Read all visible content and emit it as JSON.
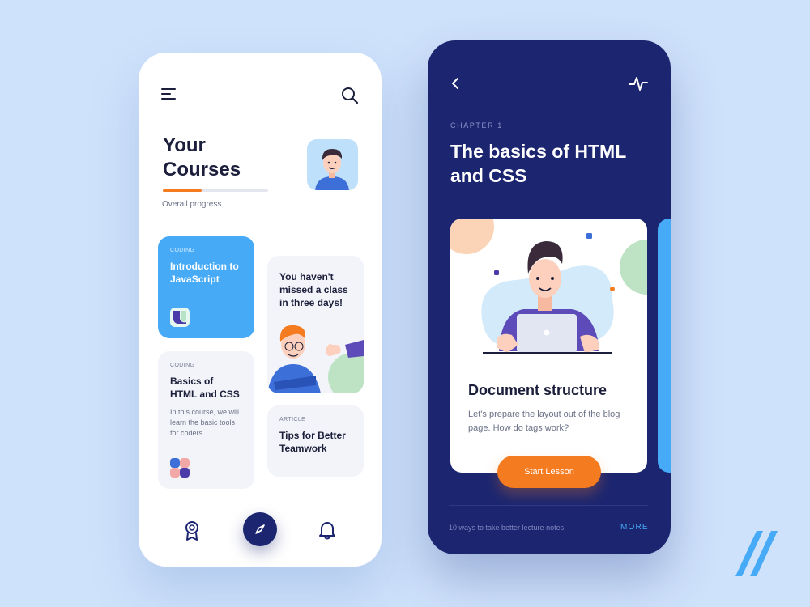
{
  "left_screen": {
    "header": {
      "menu_icon": "menu-icon",
      "search_icon": "search-icon"
    },
    "title": "Your\nCourses",
    "progress": {
      "label": "Overall progress",
      "value_percent": 37,
      "color": "#f47b20"
    },
    "cards": {
      "javascript": {
        "category": "CODING",
        "title": "Introduction to JavaScript",
        "color": "#46aaf7"
      },
      "html_css": {
        "category": "CODING",
        "title": "Basics of HTML and CSS",
        "description": "In this course, we will learn the basic tools for coders."
      },
      "message": {
        "text": "You haven't missed a class in three days!"
      },
      "tips": {
        "category": "ARTICLE",
        "title": "Tips for Better Teamwork"
      }
    },
    "bottom_nav": [
      {
        "name": "badge",
        "icon": "badge-icon"
      },
      {
        "name": "explore",
        "icon": "compass-icon",
        "active": true
      },
      {
        "name": "notifications",
        "icon": "bell-icon"
      }
    ]
  },
  "right_screen": {
    "header": {
      "back_icon": "chevron-left-icon",
      "activity_icon": "pulse-icon"
    },
    "chapter": "CHAPTER 1",
    "title": "The basics of HTML and CSS",
    "lesson": {
      "title": "Document structure",
      "description": "Let's prepare the layout out of the blog page. How do tags work?",
      "button": "Start Lesson"
    },
    "footer": {
      "note": "10 ways to take better lecture notes.",
      "more": "MORE"
    }
  },
  "colors": {
    "background": "#cfe2fb",
    "navy": "#1c2670",
    "accent_orange": "#f47b20",
    "accent_blue": "#46aaf7"
  }
}
